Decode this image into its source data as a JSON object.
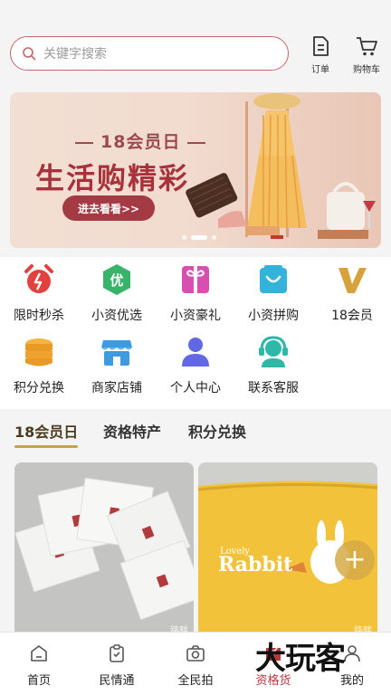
{
  "search": {
    "placeholder": "关键字搜索"
  },
  "header": {
    "orders_label": "订单",
    "cart_label": "购物车"
  },
  "banner": {
    "subtitle": "18会员日",
    "title": "生活购精彩",
    "button": "进去看看>>",
    "slides": 3,
    "active_slide": 2
  },
  "grid": [
    {
      "label": "限时秒杀",
      "icon": "alarm-clock-icon",
      "color": "#e2413e"
    },
    {
      "label": "小资优选",
      "icon": "you-badge-icon",
      "color": "#39b36a"
    },
    {
      "label": "小资豪礼",
      "icon": "gift-icon",
      "color": "#d74fb0"
    },
    {
      "label": "小资拼购",
      "icon": "shopping-bag-icon",
      "color": "#33b3d9"
    },
    {
      "label": "18会员",
      "icon": "v-icon",
      "color": "#d6a23c"
    },
    {
      "label": "积分兑换",
      "icon": "coins-icon",
      "color": "#f0a22e"
    },
    {
      "label": "商家店铺",
      "icon": "store-icon",
      "color": "#3f9be0"
    },
    {
      "label": "个人中心",
      "icon": "person-icon",
      "color": "#6068e6"
    },
    {
      "label": "联系客服",
      "icon": "headset-icon",
      "color": "#2db8a8"
    }
  ],
  "tabs": [
    {
      "label": "18会员日",
      "active": true
    },
    {
      "label": "资格特产",
      "active": false
    },
    {
      "label": "积分兑换",
      "active": false
    }
  ],
  "products": [
    {
      "watermark": "路畔"
    },
    {
      "watermark": "路畔",
      "brand_text": "Lovely",
      "brand_title": "Rabbit"
    }
  ],
  "tabbar": [
    {
      "label": "首页",
      "icon": "home-icon",
      "active": false
    },
    {
      "label": "民情通",
      "icon": "clipboard-icon",
      "active": false
    },
    {
      "label": "全民拍",
      "icon": "camera-icon",
      "active": false
    },
    {
      "label": "资格货",
      "icon": "goods-icon",
      "active": true
    },
    {
      "label": "我的",
      "icon": "user-icon",
      "active": false
    }
  ],
  "brand_watermark": "大玩客",
  "colors": {
    "accent": "#b8383e",
    "gold": "#c8a24a"
  }
}
